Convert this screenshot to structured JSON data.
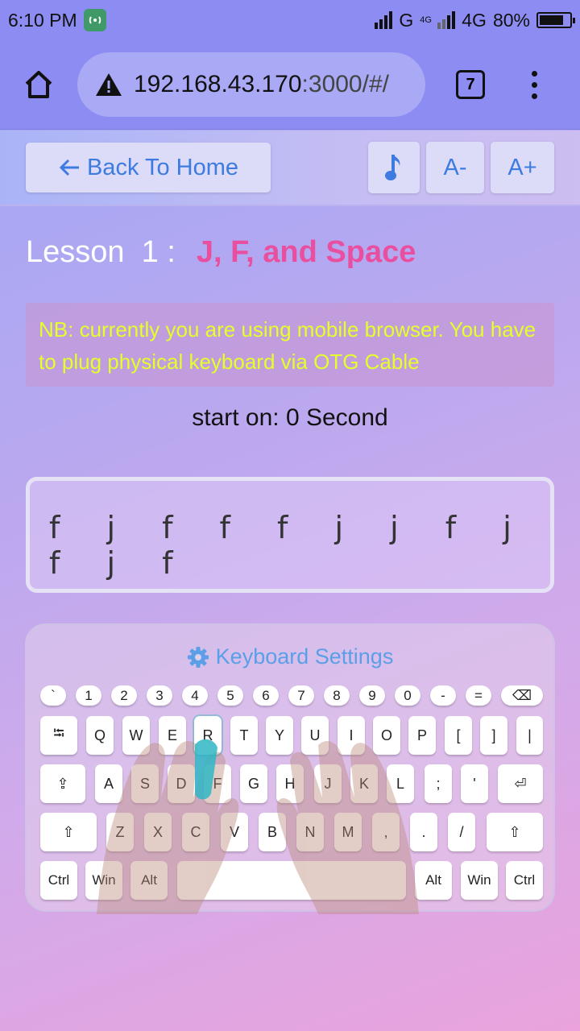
{
  "status": {
    "time": "6:10 PM",
    "network1": "G",
    "network2_small": "4G",
    "network2": "4G",
    "battery": "80%",
    "battery_level": 0.8,
    "icons": [
      "hotspot-icon",
      "signal-icon",
      "battery-icon"
    ]
  },
  "browser": {
    "url_main": "192.168.43.170",
    "url_rest": ":3000/#/",
    "tabs_count": "7",
    "icons": [
      "home-icon",
      "warning-icon",
      "menu-icon"
    ]
  },
  "toolbar": {
    "back_label": "Back To Home",
    "music_icon": "music-note-icon",
    "font_smaller": "A-",
    "font_larger": "A+"
  },
  "lesson": {
    "prefix": "Lesson  1 :",
    "name": "J, F, and Space"
  },
  "notice": "NB: currently you are using mobile browser. You have to plug physical keyboard via OTG Cable",
  "timer": "start on: 0 Second",
  "typing_text": "f j f f f j j f j f j f",
  "keyboard": {
    "settings_label": "Keyboard Settings",
    "settings_icon": "gear-icon",
    "highlighted_key": "R",
    "rows": [
      [
        "`",
        "1",
        "2",
        "3",
        "4",
        "5",
        "6",
        "7",
        "8",
        "9",
        "0",
        "-",
        "=",
        "⌫"
      ],
      [
        "⭾",
        "Q",
        "W",
        "E",
        "R",
        "T",
        "Y",
        "U",
        "I",
        "O",
        "P",
        "[",
        "]",
        "|"
      ],
      [
        "⇪",
        "A",
        "S",
        "D",
        "F",
        "G",
        "H",
        "J",
        "K",
        "L",
        ";",
        "'",
        "⏎"
      ],
      [
        "⇧",
        "Z",
        "X",
        "C",
        "V",
        "B",
        "N",
        "M",
        ",",
        ".",
        "/",
        "⇧"
      ],
      [
        "Ctrl",
        "Win",
        "Alt",
        "",
        "Alt",
        "Win",
        "Ctrl"
      ]
    ]
  },
  "colors": {
    "accent": "#3d7be0",
    "lesson_name": "#e94f9f",
    "notice_text": "#e4ff2a",
    "highlight_finger": "#2fb6c4"
  }
}
